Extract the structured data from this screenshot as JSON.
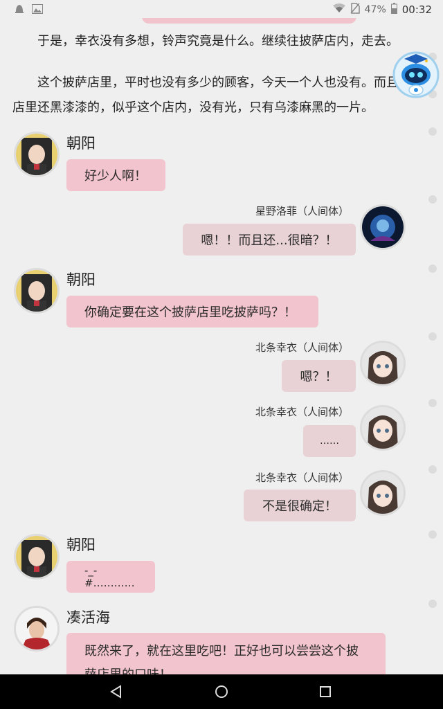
{
  "status_bar": {
    "left_icons": [
      "notification-icon",
      "image-icon"
    ],
    "wifi_icon": "wifi-icon",
    "sim_icon": "no-sim-icon",
    "battery_percent": "47%",
    "battery_icon": "battery-icon",
    "time": "00:32"
  },
  "narration": [
    "于是，幸衣没有多想，铃声究竟是什么。继续往披萨店内，走去。",
    "这个披萨店里，平时也没有多少的顾客，今天一个人也没有。而且店里还黑漆漆的，似乎这个店内，没有光，只有乌漆麻黑的一片。"
  ],
  "messages": [
    {
      "side": "left",
      "speaker": "朝阳",
      "text": "好少人啊！"
    },
    {
      "side": "right",
      "speaker": "星野洛菲（人间体）",
      "text": "嗯！！而且还...很暗？！"
    },
    {
      "side": "left",
      "speaker": "朝阳",
      "text": "你确定要在这个披萨店里吃披萨吗？！"
    },
    {
      "side": "right",
      "speaker": "北条幸衣（人间体）",
      "text": "嗯？！"
    },
    {
      "side": "right",
      "speaker": "北条幸衣（人间体）",
      "text": "……"
    },
    {
      "side": "right",
      "speaker": "北条幸衣（人间体）",
      "text": "不是很确定！"
    },
    {
      "side": "left",
      "speaker": "朝阳",
      "text": "-_-#…………"
    },
    {
      "side": "left",
      "speaker": "凑活海",
      "text": "既然来了，就在这里吃吧！正好也可以尝尝这个披萨店里的口味！"
    }
  ],
  "colors": {
    "left_bubble": "#f2c4cd",
    "right_bubble": "#e9d2d5",
    "background": "#efefef"
  },
  "navigation": {
    "back_icon": "back-triangle-icon",
    "home_icon": "home-circle-icon",
    "recents_icon": "recents-square-icon"
  }
}
